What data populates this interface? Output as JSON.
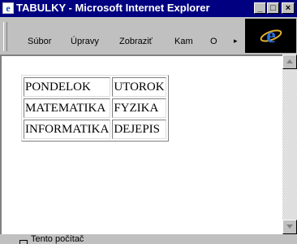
{
  "window": {
    "title": "TABULKY - Microsoft Internet Explorer",
    "controls": {
      "minimize": "_",
      "maximize": "□",
      "close": "×"
    }
  },
  "menu": {
    "items": [
      "Súbor",
      "Úpravy",
      "Zobraziť",
      "Kam",
      "O"
    ]
  },
  "content": {
    "table": [
      [
        "PONDELOK",
        "UTOROK"
      ],
      [
        "MATEMATIKA",
        "FYZIKA"
      ],
      [
        "INFORMATIKA",
        "DEJEPIS"
      ]
    ]
  },
  "status": {
    "text": "Tento počítač"
  },
  "icons": {
    "app": "ie-icon",
    "logo": "ie-logo",
    "status": "computer-icon"
  },
  "colors": {
    "titlebar": "#000080",
    "logo_bg": "#000000",
    "logo_e": "#2a6fd8"
  }
}
